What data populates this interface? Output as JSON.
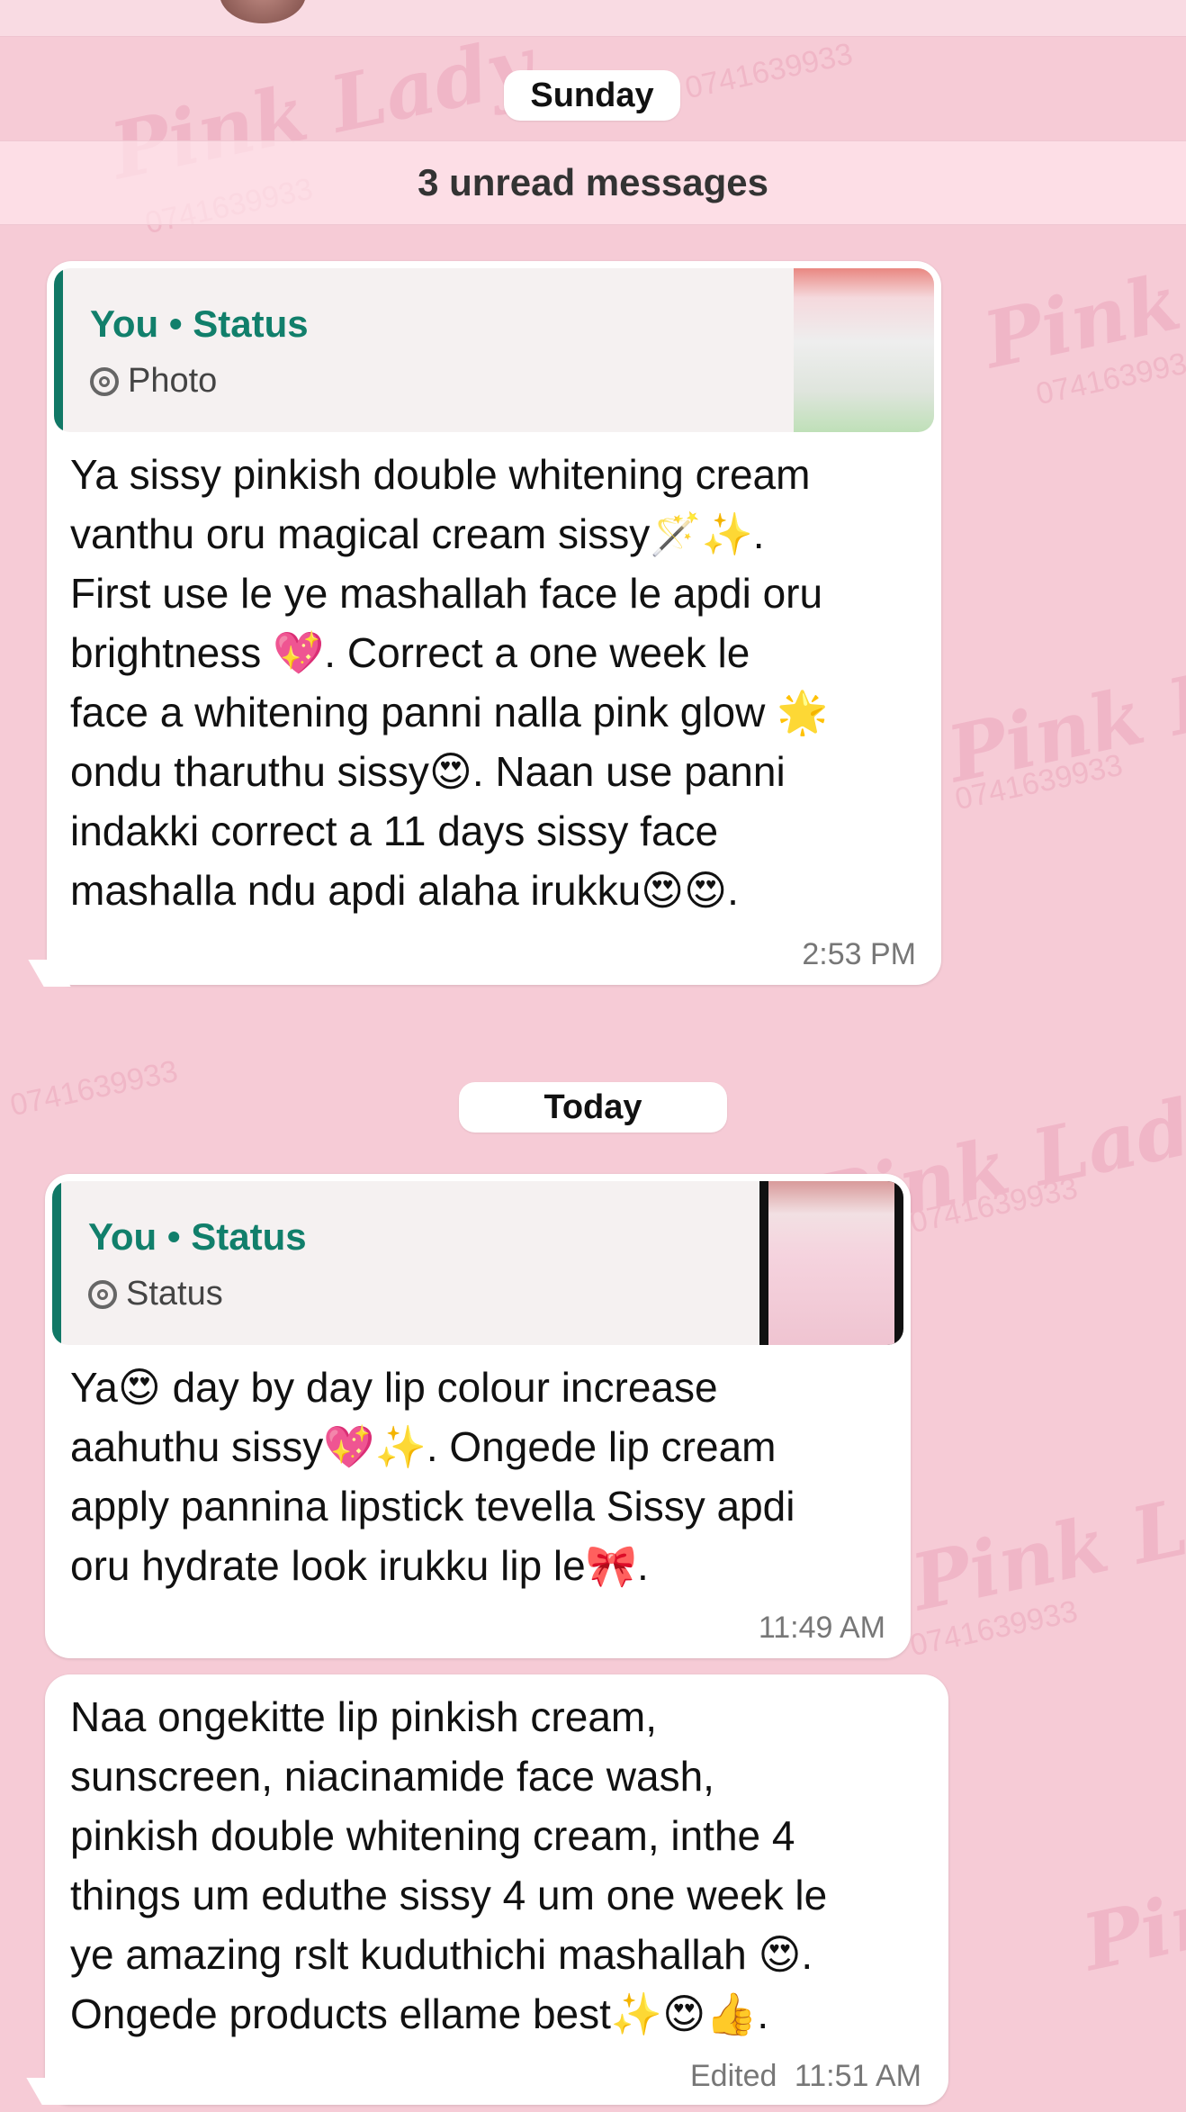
{
  "day_labels": {
    "earlier": "Sunday",
    "today": "Today"
  },
  "unread_banner": "3 unread messages",
  "watermark": {
    "brand": "Pink Lady",
    "phone": "0741639933"
  },
  "messages": [
    {
      "quote_title": "You • Status",
      "quote_media": "Photo",
      "text": "Ya sissy pinkish double whitening cream\nvanthu oru magical cream sissy🪄✨.\nFirst use le ye mashallah face le apdi oru\nbrightness 💖. Correct a one week le\nface a whitening panni nalla pink glow 🌟\nondu tharuthu sissy😍. Naan use panni\nindakki correct a 11 days sissy face\nmashalla ndu apdi alaha irukku😍😍.",
      "time": "2:53 PM"
    },
    {
      "quote_title": "You • Status",
      "quote_media": "Status",
      "text": "Ya😍 day by day lip colour increase\naahuthu sissy💖✨. Ongede lip cream\napply pannina lipstick tevella Sissy apdi\noru hydrate look irukku lip le🎀.",
      "time": "11:49 AM"
    },
    {
      "text": "Naa ongekitte lip pinkish cream,\nsunscreen, niacinamide face wash,\npinkish double whitening cream, inthe 4\nthings um eduthe sissy 4 um one week le\nye amazing rslt kuduthichi mashallah 😍.\nOngede products ellame best✨😍👍.",
      "edited_label": "Edited",
      "time": "11:51 AM"
    }
  ],
  "colors": {
    "background": "#f6cbd6",
    "bubble": "#ffffff",
    "quote_accent": "#117866"
  }
}
